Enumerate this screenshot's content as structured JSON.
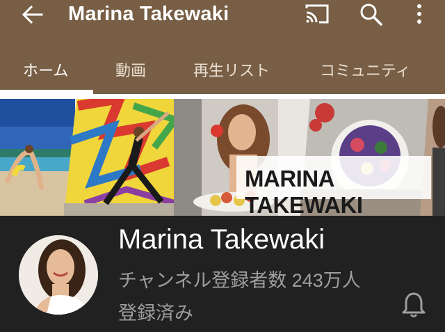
{
  "header": {
    "title": "Marina Takewaki",
    "icons": [
      "back-arrow-icon",
      "cast-icon",
      "search-icon",
      "more-vertical-icon"
    ]
  },
  "tabs": [
    {
      "label": "ホーム",
      "active": true
    },
    {
      "label": "動画",
      "active": false
    },
    {
      "label": "再生リスト",
      "active": false
    },
    {
      "label": "コミュニティ",
      "active": false
    }
  ],
  "banner": {
    "title": "MARINA TAKEWAKI"
  },
  "channel": {
    "name": "Marina Takewaki",
    "subscribers": "チャンネル登録者数 243万人",
    "subscription_status": "登録済み"
  },
  "colors": {
    "appbar": "#775e44",
    "background": "#212121",
    "secondary_text": "#9e9e9e"
  }
}
